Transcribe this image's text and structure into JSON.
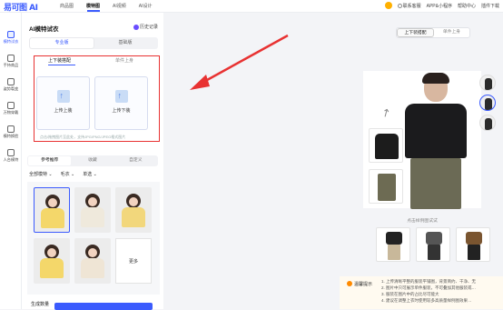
{
  "app": {
    "logo_text": "易可图",
    "logo_suffix": "AI"
  },
  "nav": {
    "items": [
      "商品图",
      "模特图",
      "AI视频",
      "AI设计"
    ],
    "active_index": 1
  },
  "topright": {
    "items": [
      "联系客服",
      "APP&小程序",
      "帮助中心",
      "插件下载"
    ]
  },
  "iconbar": {
    "items": [
      "模特试衣",
      "手持商品",
      "姿势裂变",
      "万物穿戴",
      "模特换脸",
      "人台模特"
    ]
  },
  "panel": {
    "title": "AI模特试衣",
    "history": "历史记录",
    "modes": [
      "专业版",
      "基础版"
    ],
    "upload_tabs": [
      "上下装搭配",
      "单件上身"
    ],
    "upload_top": "上传上装",
    "upload_bottom": "上传下装",
    "upload_hint": "点击/拖拽图片至此处，支持JPG/PNG/JPEG格式图片",
    "ref_tabs": [
      "参考推荐",
      "收藏",
      "自定义"
    ],
    "filters": [
      "全部模特",
      "毛衣",
      "单选"
    ],
    "more": "更多",
    "bottom_label": "生成数量"
  },
  "canvas": {
    "tabs": [
      "上下装搭配",
      "单件上身"
    ],
    "click_hint": "点击样例图试试",
    "tip_label": "温馨提示",
    "tips": [
      "1. 上传清晰平整的服装平铺图，背景简约、干净、无",
      "2. 图片中只可展示单件服装，不可叠加其他服装或…",
      "3. 服装在图片中的占比尽可能大",
      "4. 建议在调整上衣时使用较多高质量样例图效果…"
    ]
  },
  "colors": {
    "accent": "#3b5bfd",
    "highlight": "#e83232",
    "warning": "#ff8a00"
  }
}
